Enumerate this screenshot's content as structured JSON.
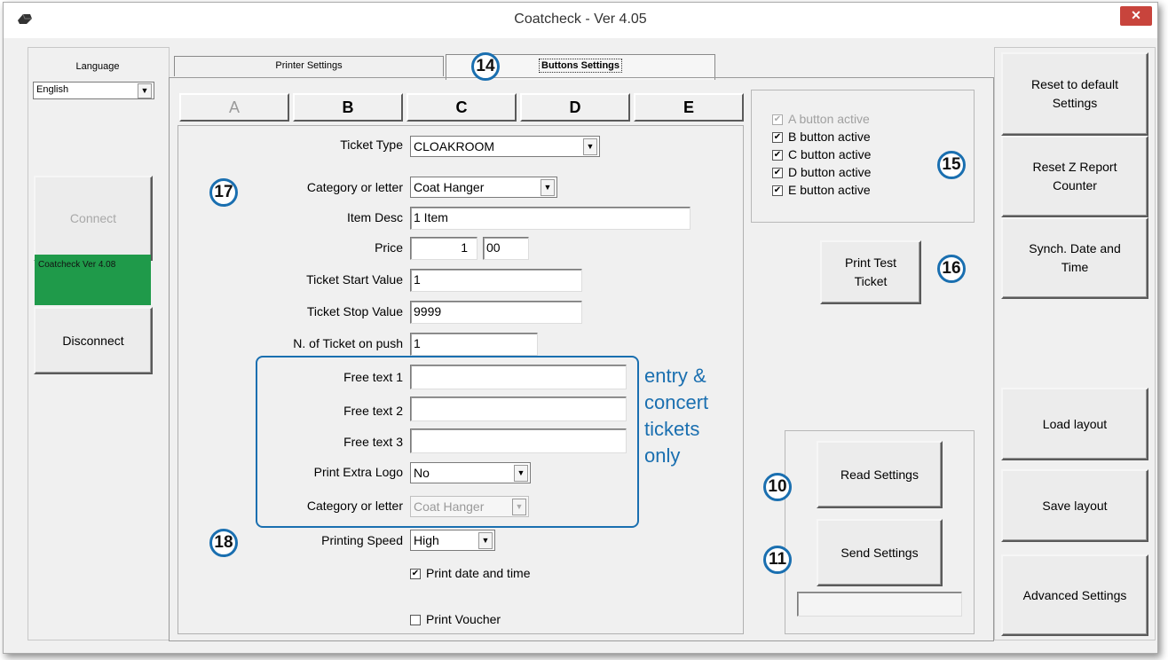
{
  "window": {
    "title": "Coatcheck - Ver 4.05",
    "close_label": "✕"
  },
  "left": {
    "language_label": "Language",
    "language_value": "English",
    "connect_label": "Connect",
    "status_text": "Coatcheck Ver 4.08",
    "status_color": "#1f9a4a",
    "disconnect_label": "Disconnect"
  },
  "tabs": [
    {
      "label": "Printer Settings"
    },
    {
      "label": "Buttons Settings"
    }
  ],
  "segments": [
    {
      "label": "A"
    },
    {
      "label": "B"
    },
    {
      "label": "C"
    },
    {
      "label": "D"
    },
    {
      "label": "E"
    }
  ],
  "form": {
    "ticket_type": {
      "label": "Ticket Type",
      "value": "CLOAKROOM"
    },
    "category": {
      "label": "Category or letter",
      "value": "Coat Hanger"
    },
    "item_desc": {
      "label": "Item Desc",
      "value": "1 Item"
    },
    "price": {
      "label": "Price",
      "value_int": "1",
      "value_dec": "00"
    },
    "start": {
      "label": "Ticket Start Value",
      "value": "1"
    },
    "stop": {
      "label": "Ticket Stop Value",
      "value": "9999"
    },
    "per_push": {
      "label": "N. of Ticket on push",
      "value": "1"
    },
    "free1": {
      "label": "Free text 1",
      "value": ""
    },
    "free2": {
      "label": "Free text 2",
      "value": ""
    },
    "free3": {
      "label": "Free text 3",
      "value": ""
    },
    "extra_logo": {
      "label": "Print Extra Logo",
      "value": "No"
    },
    "category2": {
      "label": "Category or letter",
      "value": "Coat Hanger"
    },
    "speed": {
      "label": "Printing Speed",
      "value": "High"
    },
    "print_datetime": {
      "label": "Print date and time",
      "checked": true
    },
    "print_voucher": {
      "label": "Print Voucher",
      "checked": false
    }
  },
  "note": {
    "line1": "entry &",
    "line2": "concert",
    "line3": "tickets",
    "line4": "only"
  },
  "active_buttons": [
    {
      "label": "A button active",
      "checked": true,
      "enabled": false
    },
    {
      "label": "B button active",
      "checked": true,
      "enabled": true
    },
    {
      "label": "C button active",
      "checked": true,
      "enabled": true
    },
    {
      "label": "D button active",
      "checked": true,
      "enabled": true
    },
    {
      "label": "E button active",
      "checked": true,
      "enabled": true
    }
  ],
  "middle": {
    "print_test_l1": "Print Test",
    "print_test_l2": "Ticket",
    "read_settings": "Read Settings",
    "send_settings": "Send Settings"
  },
  "right": {
    "reset_default_l1": "Reset to default",
    "reset_default_l2": "Settings",
    "reset_z_l1": "Reset Z Report",
    "reset_z_l2": "Counter",
    "synch_l1": "Synch. Date and",
    "synch_l2": "Time",
    "load_layout": "Load layout",
    "save_layout": "Save layout",
    "advanced": "Advanced Settings"
  },
  "badges": {
    "b14": "14",
    "b15": "15",
    "b16": "16",
    "b17": "17",
    "b18": "18",
    "b10": "10",
    "b11": "11"
  },
  "colors": {
    "accent": "#1a6fb0",
    "close": "#c8443c"
  }
}
